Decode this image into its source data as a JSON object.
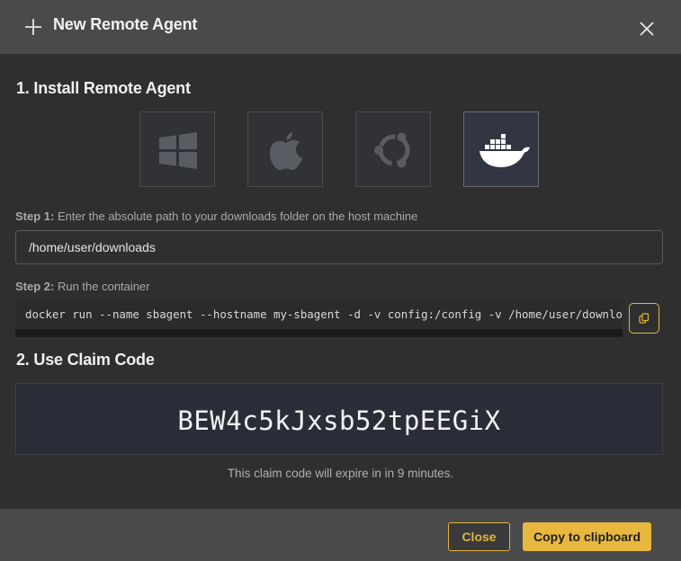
{
  "dialog": {
    "title": "New Remote Agent",
    "title_icon": "plus-icon",
    "close_icon": "close-icon"
  },
  "install": {
    "heading": "1. Install Remote Agent",
    "platforms": [
      {
        "name": "windows",
        "icon": "windows-icon",
        "selected": false
      },
      {
        "name": "macos",
        "icon": "apple-icon",
        "selected": false
      },
      {
        "name": "ubuntu",
        "icon": "ubuntu-icon",
        "selected": false
      },
      {
        "name": "docker",
        "icon": "docker-icon",
        "selected": true
      }
    ],
    "step1": {
      "label_bold": "Step 1:",
      "label_text": " Enter the absolute path to your downloads folder on the host machine",
      "input_value": "/home/user/downloads"
    },
    "step2": {
      "label_bold": "Step 2:",
      "label_text": " Run the container",
      "command": "docker run --name sbagent --hostname my-sbagent -d -v config:/config -v /home/user/downloa",
      "copy_icon": "copy-icon"
    }
  },
  "claim": {
    "heading": "2. Use Claim Code",
    "code": "BEW4c5kJxsb52tpEEGiX",
    "expiry_text": "This claim code will expire in in 9 minutes."
  },
  "footer": {
    "close_label": "Close",
    "copy_label": "Copy to clipboard"
  },
  "colors": {
    "accent": "#e8b83e",
    "header_bg": "#4a4a4a",
    "body_bg": "#2f2f2f",
    "claim_bg": "#2a2d38"
  }
}
